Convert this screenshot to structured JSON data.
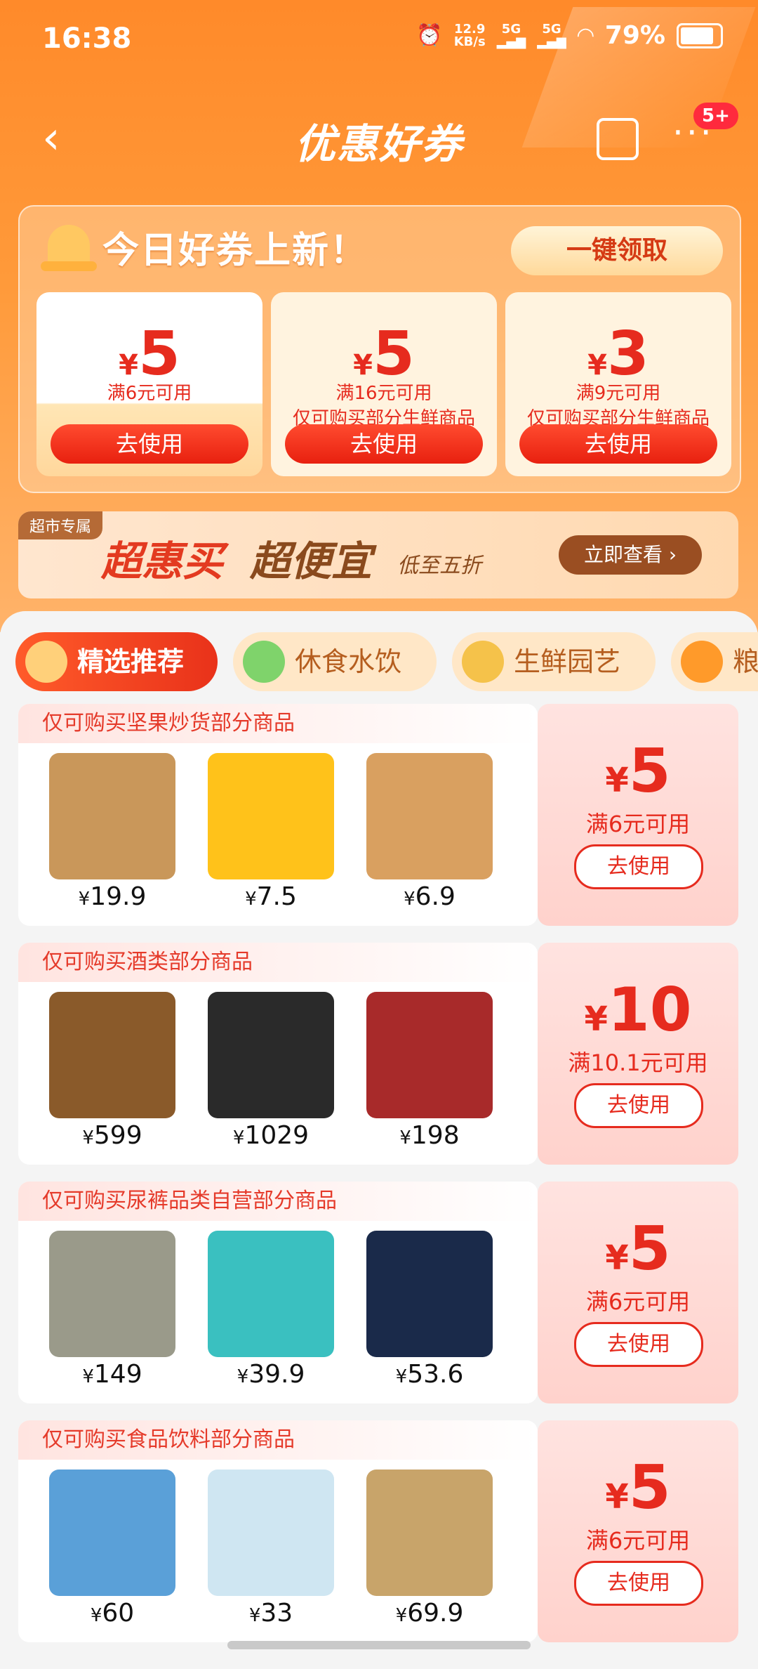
{
  "status_bar": {
    "time": "16:38",
    "net_speed": "12.9\nKB/s",
    "sig1": "5G",
    "sig2": "5G",
    "battery": "79%"
  },
  "nav": {
    "title": "优惠好券",
    "badge": "5+"
  },
  "coupon_panel": {
    "title": "今日好券上新！",
    "claim_all": "一键领取",
    "coupons": [
      {
        "currency": "¥",
        "amount": "5",
        "condition": "满6元可用",
        "note": "",
        "button": "去使用"
      },
      {
        "currency": "¥",
        "amount": "5",
        "condition": "满16元可用",
        "note": "仅可购买部分生鲜商品",
        "button": "去使用"
      },
      {
        "currency": "¥",
        "amount": "3",
        "condition": "满9元可用",
        "note": "仅可购买部分生鲜商品",
        "button": "去使用"
      }
    ]
  },
  "banner": {
    "tag": "超市专属",
    "t1": "超惠买",
    "t2": "超便宜",
    "t3": "低至五折",
    "button": "立即查看"
  },
  "tabs": [
    {
      "label": "精选推荐",
      "active": true,
      "icon_color": "#ffd07a"
    },
    {
      "label": "休食水饮",
      "active": false,
      "icon_color": "#7fd36b"
    },
    {
      "label": "生鲜园艺",
      "active": false,
      "icon_color": "#f5c24a"
    },
    {
      "label": "粮",
      "active": false,
      "icon_color": "#ff9a2a"
    }
  ],
  "cards": [
    {
      "title": "仅可购买坚果炒货部分商品",
      "amount": "5",
      "condition": "满6元可用",
      "button": "去使用",
      "products": [
        {
          "price": "19.9",
          "color": "#c9975a"
        },
        {
          "price": "7.5",
          "color": "#ffc21a"
        },
        {
          "price": "6.9",
          "color": "#d9a060"
        }
      ]
    },
    {
      "title": "仅可购买酒类部分商品",
      "amount": "10",
      "condition": "满10.1元可用",
      "button": "去使用",
      "products": [
        {
          "price": "599",
          "color": "#8a5a2a"
        },
        {
          "price": "1029",
          "color": "#2a2a2a"
        },
        {
          "price": "198",
          "color": "#a82a2a"
        }
      ]
    },
    {
      "title": "仅可购买尿裤品类自营部分商品",
      "amount": "5",
      "condition": "满6元可用",
      "button": "去使用",
      "products": [
        {
          "price": "149",
          "color": "#9a9a8a"
        },
        {
          "price": "39.9",
          "color": "#3ac0c0"
        },
        {
          "price": "53.6",
          "color": "#1a2a4a"
        }
      ]
    },
    {
      "title": "仅可购买食品饮料部分商品",
      "amount": "5",
      "condition": "满6元可用",
      "button": "去使用",
      "products": [
        {
          "price": "60",
          "color": "#5aa0d8"
        },
        {
          "price": "33",
          "color": "#cfe6f2"
        },
        {
          "price": "69.9",
          "color": "#c8a46a"
        }
      ]
    }
  ],
  "currency": "¥"
}
